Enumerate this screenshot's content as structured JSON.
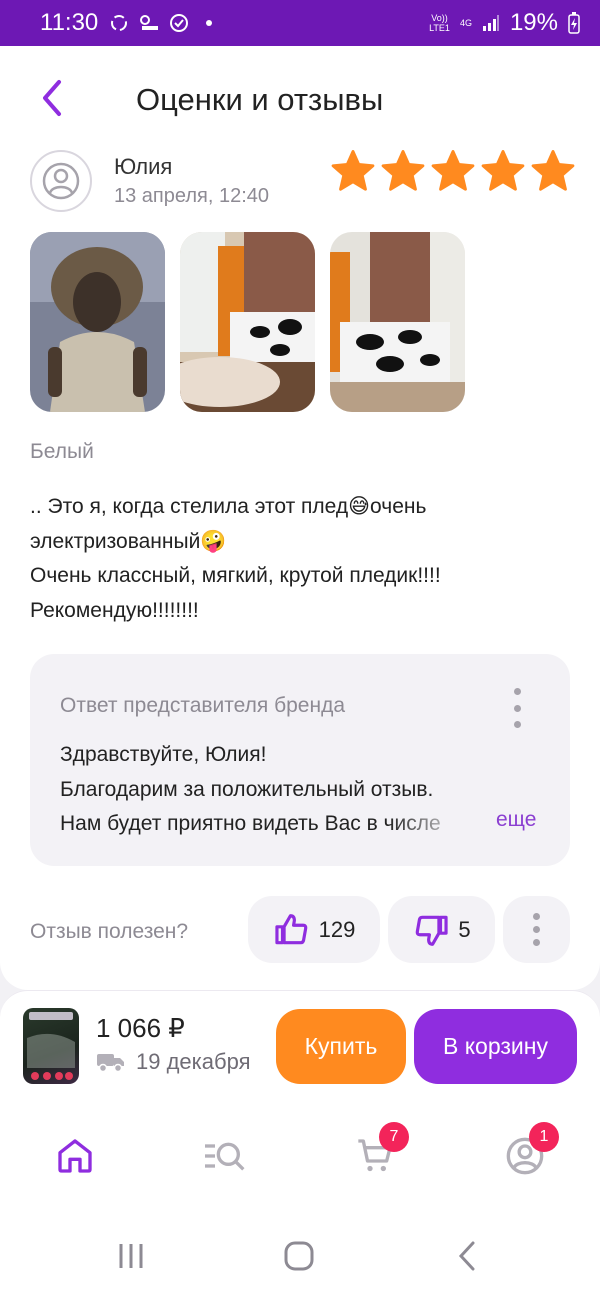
{
  "status_bar": {
    "time": "11:30",
    "network_top": "Vo))",
    "network_bottom": "LTE1",
    "net_type": "4G",
    "battery": "19%"
  },
  "header": {
    "title": "Оценки и отзывы"
  },
  "review": {
    "author": "Юлия",
    "date": "13 апреля, 12:40",
    "rating": 5,
    "variant": "Белый",
    "text_lines": [
      ".. Это я, когда стелила этот плед😅очень",
      "электризованный🤪",
      "Очень классный, мягкий, крутой пледик!!!!",
      "Рекомендую!!!!!!!!"
    ]
  },
  "brand_reply": {
    "title": "Ответ представителя бренда",
    "lines": [
      "Здравствуйте, Юлия!",
      "Благодарим за положительный отзыв.",
      "Нам будет приятно видеть Вас в числе"
    ],
    "more_label": "еще"
  },
  "helpful": {
    "label": "Отзыв полезен?",
    "likes": "129",
    "dislikes": "5"
  },
  "purchase": {
    "price": "1 066 ₽",
    "delivery_date": "19 декабря",
    "buy_label": "Купить",
    "cart_label": "В корзину"
  },
  "tabs": {
    "cart_badge": "7",
    "profile_badge": "1"
  },
  "colors": {
    "accent_purple": "#8f2ddf",
    "status_bar": "#6d18b4",
    "star_orange": "#ff8a1f",
    "buy_orange": "#ff8a1f",
    "badge_red": "#f3245a"
  }
}
